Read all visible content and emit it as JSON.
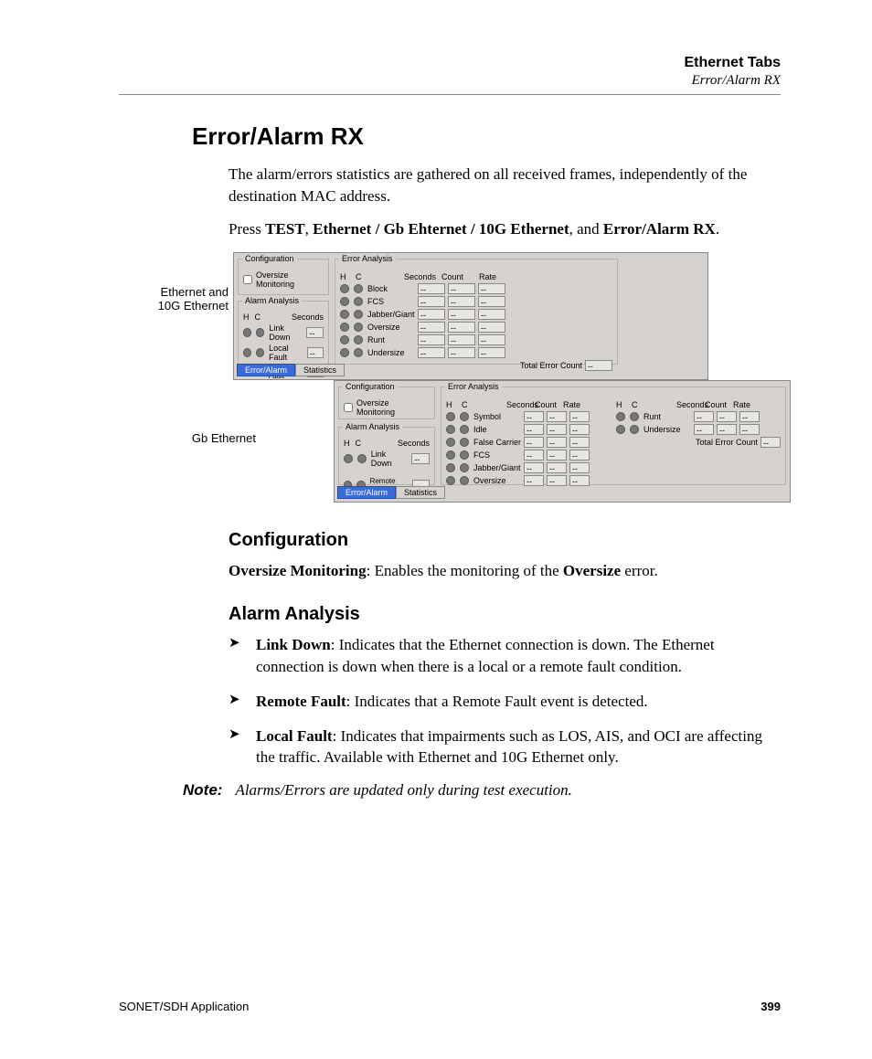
{
  "header": {
    "title": "Ethernet Tabs",
    "subtitle": "Error/Alarm RX"
  },
  "h1": "Error/Alarm RX",
  "intro1": "The alarm/errors statistics are gathered on all received frames, independently of the destination MAC address.",
  "press_pre": "Press ",
  "press_b1": "TEST",
  "press_sep1": ", ",
  "press_b2": "Ethernet / Gb Ehternet / 10G Ethernet",
  "press_sep2": ", and ",
  "press_b3": "Error/Alarm RX",
  "press_post": ".",
  "annot1a": "Ethernet and",
  "annot1b": "10G Ethernet",
  "annot2": "Gb Ethernet",
  "ui": {
    "config_title": "Configuration",
    "oversize_chk": "Oversize Monitoring",
    "alarm_title": "Alarm Analysis",
    "error_title": "Error Analysis",
    "col_h": "H",
    "col_c": "C",
    "col_seconds": "Seconds",
    "col_count": "Count",
    "col_rate": "Rate",
    "link_down": "Link Down",
    "local_fault": "Local Fault",
    "remote_fault": "Remote Fault",
    "block": "Block",
    "fcs": "FCS",
    "jabber": "Jabber/Giant",
    "oversize": "Oversize",
    "runt": "Runt",
    "undersize": "Undersize",
    "symbol": "Symbol",
    "idle": "Idle",
    "false_carrier": "False Carrier",
    "total": "Total Error Count",
    "dash": "--",
    "tab_active": "Error/Alarm",
    "tab_other": "Statistics"
  },
  "h2_config": "Configuration",
  "config_b": "Oversize Monitoring",
  "config_txt": ": Enables the monitoring of the ",
  "config_b2": "Oversize",
  "config_txt2": " error.",
  "h2_alarm": "Alarm Analysis",
  "li1_b": "Link Down",
  "li1": ": Indicates that the Ethernet connection is down. The Ethernet connection is down when there is a local or a remote fault condition.",
  "li2_b": "Remote Fault",
  "li2": ": Indicates that a Remote Fault event is detected.",
  "li3_b": "Local Fault",
  "li3": ": Indicates that impairments such as LOS, AIS, and OCI are affecting the traffic. Available with Ethernet and 10G Ethernet only.",
  "note_label": "Note:",
  "note_txt": "Alarms/Errors are updated only during test execution.",
  "footer_left": "SONET/SDH Application",
  "footer_right": "399"
}
